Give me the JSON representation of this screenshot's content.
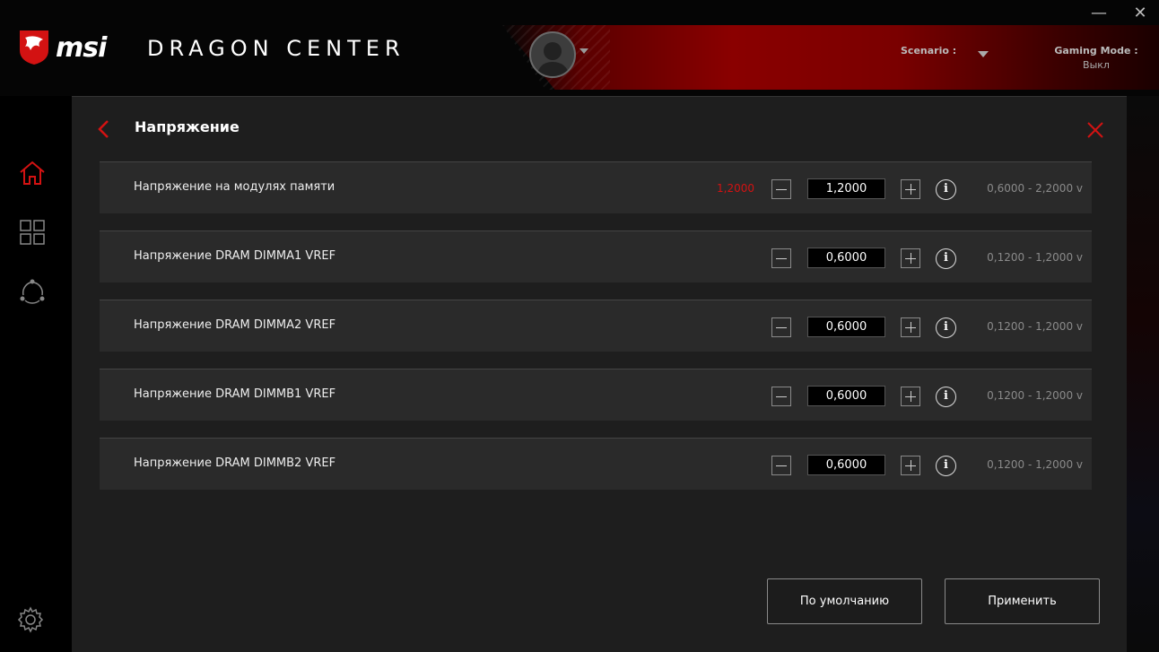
{
  "header": {
    "brand": "msi",
    "app_title": "DRAGON CENTER",
    "scenario_label": "Scenario :",
    "gaming_mode_label": "Gaming Mode :",
    "gaming_mode_value": "Выкл",
    "minimize_glyph": "—",
    "close_glyph": "✕"
  },
  "sidebar": {
    "items": [
      {
        "icon": "home-icon",
        "active": true
      },
      {
        "icon": "grid-icon",
        "active": false
      },
      {
        "icon": "share-network-icon",
        "active": false
      }
    ],
    "bottom_icon": "gear-icon"
  },
  "panel": {
    "title": "Напряжение",
    "rows": [
      {
        "label": "Напряжение на модулях памяти",
        "current": "1,2000",
        "value": "1,2000",
        "range": "0,6000 - 2,2000 v"
      },
      {
        "label": "Напряжение DRAM DIMMA1 VREF",
        "current": "",
        "value": "0,6000",
        "range": "0,1200 - 1,2000 v"
      },
      {
        "label": "Напряжение DRAM DIMMA2 VREF",
        "current": "",
        "value": "0,6000",
        "range": "0,1200 - 1,2000 v"
      },
      {
        "label": "Напряжение DRAM DIMMB1 VREF",
        "current": "",
        "value": "0,6000",
        "range": "0,1200 - 1,2000 v"
      },
      {
        "label": "Напряжение DRAM DIMMB2 VREF",
        "current": "",
        "value": "0,6000",
        "range": "0,1200 - 1,2000 v"
      }
    ],
    "info_glyph": "i",
    "default_button": "По умолчанию",
    "apply_button": "Применить"
  },
  "colors": {
    "accent": "#d31212",
    "panel_bg": "#1e1e1e",
    "row_bg": "#2a2a2a"
  }
}
